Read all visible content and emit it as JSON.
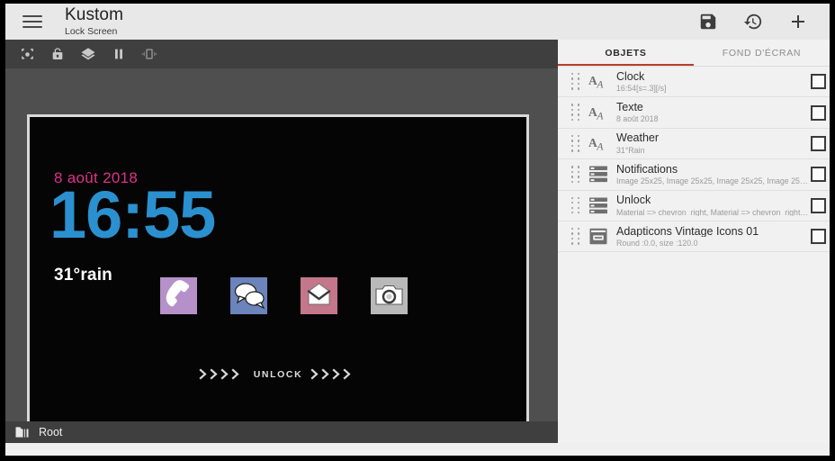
{
  "appbar": {
    "menu_icon": "hamburger-menu-icon",
    "title": "Kustom",
    "subtitle": "Lock Screen",
    "actions": [
      {
        "name": "save-button",
        "icon": "floppy-save-icon"
      },
      {
        "name": "history-button",
        "icon": "history-clock-icon"
      },
      {
        "name": "add-button",
        "icon": "plus-icon"
      }
    ]
  },
  "subtoolbar": {
    "buttons": [
      {
        "name": "screenshot-button",
        "icon": "crop-focus-icon"
      },
      {
        "name": "lock-button",
        "icon": "unlocked-padlock-icon"
      },
      {
        "name": "layers-button",
        "icon": "layers-icon"
      },
      {
        "name": "pause-button",
        "icon": "pause-icon"
      },
      {
        "name": "vibrate-button",
        "icon": "vibrate-icon"
      }
    ]
  },
  "preview": {
    "date": "8 août 2018",
    "time": "16:55",
    "weather": "31°rain",
    "unlock_label": "UNLOCK",
    "chevron_count": 4,
    "colors": {
      "date": "#e0308a",
      "time": "#2b90cf",
      "weather": "#ffffff",
      "background": "#050505"
    },
    "icons": [
      {
        "name": "phone-icon",
        "label": "Phone",
        "bg": "#b690c9"
      },
      {
        "name": "messages-icon",
        "label": "Messages",
        "bg": "#6b84bb"
      },
      {
        "name": "mail-icon",
        "label": "Mail",
        "bg": "#c4768a"
      },
      {
        "name": "camera-icon",
        "label": "Camera",
        "bg": "#b9b9b9"
      }
    ]
  },
  "rootbar": {
    "icon": "folder-icon",
    "label": "Root"
  },
  "rightpane": {
    "tabs": [
      {
        "label": "OBJETS",
        "active": true
      },
      {
        "label": "FOND D'ÉCRAN",
        "active": false
      }
    ],
    "accent_color": "#b5402c",
    "items": [
      {
        "title": "Clock",
        "subtitle": "16:54[s=.3][/s]",
        "icon": "text-font-icon",
        "checked": false
      },
      {
        "title": "Texte",
        "subtitle": "8 août 2018",
        "icon": "text-font-icon",
        "checked": false
      },
      {
        "title": "Weather",
        "subtitle": "31°Rain",
        "icon": "text-font-icon",
        "checked": false
      },
      {
        "title": "Notifications",
        "subtitle": "Image 25x25, Image 25x25, Image 25x25, Image 25x25,.",
        "icon": "stack-list-icon",
        "checked": false
      },
      {
        "title": "Unlock",
        "subtitle": "Material => chevron_right, Material => chevron_right, Ma.",
        "icon": "stack-list-icon",
        "checked": false
      },
      {
        "title": "Adapticons Vintage Icons 01",
        "subtitle": "Round :0.0, size :120.0",
        "icon": "card-module-icon",
        "checked": false
      }
    ]
  }
}
